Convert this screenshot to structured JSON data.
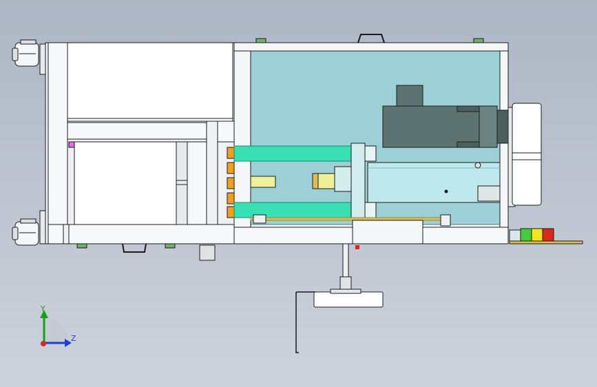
{
  "app": {
    "view_name": "CAD top view",
    "colors": {
      "background_top": "#adb6c4",
      "background_bottom": "#cdd3dc",
      "frame_fill": "#f2f4f6",
      "frame_stroke": "#1b1b1b",
      "cover_glass": "#9ccfd6",
      "rail": "#39e0b3",
      "motor": "#5c7371",
      "cylinder": "#bfe7ee",
      "orange_block": "#f0a020",
      "yellow_block": "#eef09a",
      "light_green": "#46c93a",
      "light_yellow": "#f3e51d",
      "light_red": "#d8291e",
      "brass_plate": "#d8be55",
      "magenta_marker": "#e26ae8"
    }
  },
  "triad": {
    "y_label": "Y",
    "z_label": "Z",
    "icons": [
      "axis-y-arrow-icon",
      "axis-z-arrow-icon",
      "axis-x-origin-icon"
    ]
  }
}
